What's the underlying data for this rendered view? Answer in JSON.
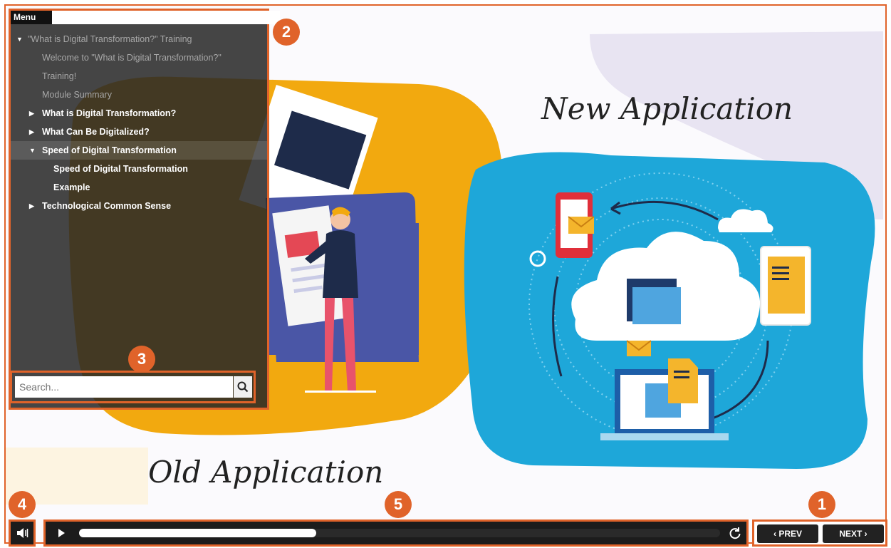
{
  "slide": {
    "heading_new": "New Application",
    "heading_old": "Old Application"
  },
  "menu": {
    "tab_label": "Menu",
    "items": [
      {
        "label": "\"What is Digital Transformation?\" Training"
      },
      {
        "label": "Welcome to \"What is Digital Transformation?\""
      },
      {
        "label": "Training!"
      },
      {
        "label": "Module Summary"
      },
      {
        "label": "What is Digital Transformation?"
      },
      {
        "label": "What Can Be Digitalized?"
      },
      {
        "label": "Speed of Digital Transformation"
      },
      {
        "label": "Speed of Digital Transformation"
      },
      {
        "label": "Example"
      },
      {
        "label": "Technological Common Sense"
      }
    ],
    "search_placeholder": "Search..."
  },
  "player": {
    "progress": 0.37
  },
  "nav": {
    "prev_label": "PREV",
    "next_label": "NEXT"
  },
  "callouts": [
    "1",
    "2",
    "3",
    "4",
    "5"
  ],
  "colors": {
    "accent": "#e0632a",
    "panel": "#262626",
    "blue_blob": "#1ea7d9",
    "orange_blob": "#f2a90f",
    "purple_folder": "#4a56a6"
  },
  "icons": [
    "search-icon",
    "speaker-icon",
    "play-icon",
    "replay-icon",
    "chevron-left-icon",
    "chevron-right-icon"
  ]
}
